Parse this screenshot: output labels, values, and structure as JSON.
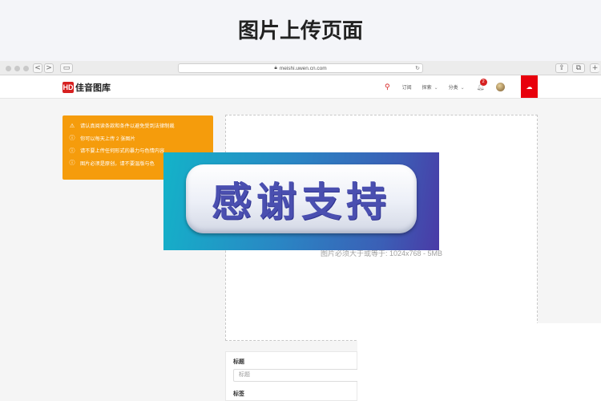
{
  "page_heading": "图片上传页面",
  "browser": {
    "url": "meishi.uwen.cn.com",
    "nav_back": "<",
    "nav_forward": ">"
  },
  "site": {
    "logo_mark": "HD",
    "logo_text": "佳音图库",
    "nav": {
      "subscribe": "订阅",
      "explore": "探索",
      "category": "分类",
      "notification_count": "2"
    }
  },
  "notice": {
    "items": [
      {
        "icon": "warning-icon",
        "text": "请认真阅读条款和条件以避免受到法律制裁"
      },
      {
        "icon": "info-icon",
        "text": "你可以每天上传 2 张图片"
      },
      {
        "icon": "info-icon",
        "text": "请不要上传任何形式的暴力与色情内容"
      },
      {
        "icon": "info-icon",
        "text": "图片必须是原创，请不要温版与色"
      }
    ]
  },
  "dropzone": {
    "hint": "图片必须大于或等于: 1024x768 - 5MB"
  },
  "form": {
    "title_label": "标题",
    "title_placeholder": "标题",
    "tags_label": "标签"
  },
  "overlay": {
    "text": "感谢支持"
  },
  "colors": {
    "brand_red": "#e8000c",
    "notice_orange": "#f59c0c"
  }
}
